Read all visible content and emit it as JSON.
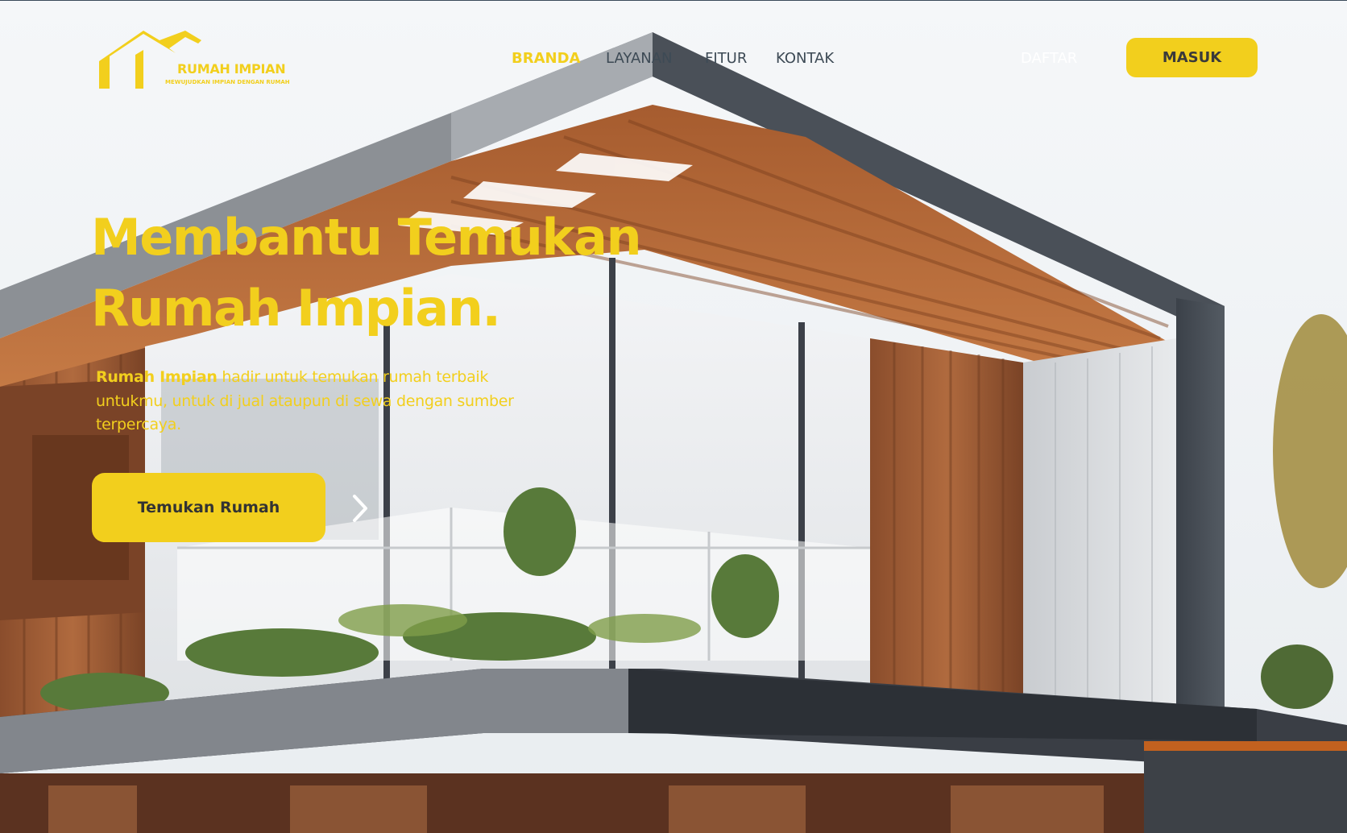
{
  "brand": {
    "name": "RUMAH IMPIAN",
    "tagline": "MEWUJUDKAN IMPIAN DENGAN RUMAH",
    "logo_icon": "house-roof-icon"
  },
  "nav": {
    "items": [
      {
        "label": "BRANDA",
        "active": true
      },
      {
        "label": "LAYANAN"
      },
      {
        "label": "FITUR"
      },
      {
        "label": "KONTAK"
      }
    ]
  },
  "auth": {
    "register_label": "DAFTAR",
    "login_label": "MASUK"
  },
  "hero": {
    "title_line1": "Membantu Temukan",
    "title_line2": "Rumah Impian.",
    "desc_brand": "Rumah Impian",
    "desc_text": " hadir untuk temukan rumah terbaik untukmu, untuk di jual ataupun di sewa dengan sumber terpercaya.",
    "cta_label": "Temukan Rumah",
    "arrow_icon": "chevron-right-icon"
  },
  "colors": {
    "accent": "#f2cf1d",
    "nav_text": "#3d4a55"
  }
}
